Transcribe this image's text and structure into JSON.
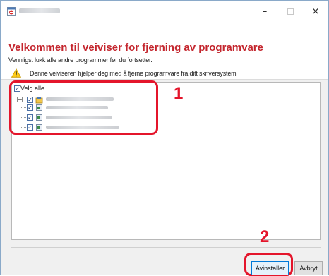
{
  "window": {
    "title_text": "",
    "controls": {
      "minimize": "–",
      "maximize": "",
      "close": "×"
    }
  },
  "header": {
    "title": "Velkommen til veiviser for fjerning av programvare",
    "subtitle": "Vennligst lukk alle andre programmer før du fortsetter.",
    "warning": "Denne veiviseren hjelper deg med å fjerne programvare fra ditt skriversystem"
  },
  "tree": {
    "select_all": {
      "label": "Velg alle",
      "checked": true
    },
    "expander": "+",
    "items": [
      {
        "checked": true,
        "label": ""
      },
      {
        "checked": true,
        "label": ""
      },
      {
        "checked": true,
        "label": ""
      },
      {
        "checked": true,
        "label": ""
      }
    ]
  },
  "callouts": {
    "one": "1",
    "two": "2"
  },
  "buttons": {
    "uninstall": "Avinstaller",
    "cancel": "Avbryt"
  },
  "colors": {
    "title_red": "#c4262e",
    "highlight_red": "#e4152b",
    "primary_border": "#0078d7"
  },
  "icons": {
    "app": "uninstall-app-icon",
    "warning": "warning-icon",
    "items": [
      "package-icon",
      "driver-icon",
      "driver-icon",
      "driver-icon"
    ]
  }
}
